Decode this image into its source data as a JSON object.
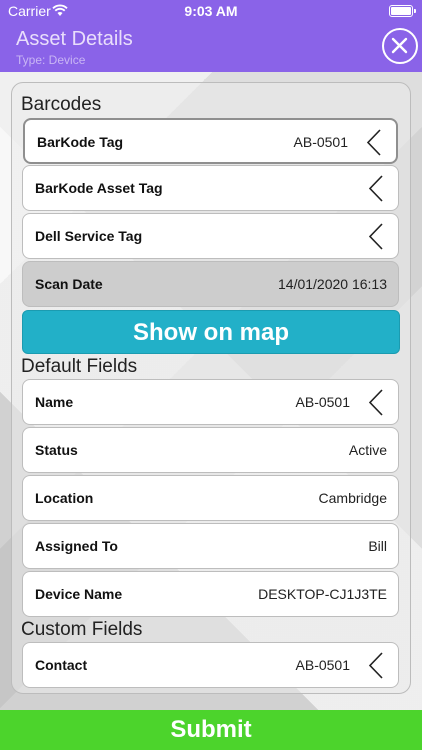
{
  "status_bar": {
    "carrier": "Carrier",
    "time": "9:03 AM"
  },
  "header": {
    "title": "Asset Details",
    "subtitle": "Type: Device",
    "close_icon": "close-icon"
  },
  "sections": {
    "barcodes": "Barcodes",
    "default_fields": "Default Fields",
    "custom_fields": "Custom Fields"
  },
  "barcodes": [
    {
      "label": "BarKode Tag",
      "value": "AB-0501",
      "chevron": true
    },
    {
      "label": "BarKode Asset Tag",
      "value": "",
      "chevron": true
    },
    {
      "label": "Dell Service Tag",
      "value": "",
      "chevron": true
    },
    {
      "label": "Scan Date",
      "value": "14/01/2020 16:13",
      "chevron": false
    }
  ],
  "map_button": "Show on map",
  "default_fields": [
    {
      "label": "Name",
      "value": "AB-0501",
      "chevron": true
    },
    {
      "label": "Status",
      "value": "Active",
      "chevron": false
    },
    {
      "label": "Location",
      "value": "Cambridge",
      "chevron": false
    },
    {
      "label": "Assigned To",
      "value": "Bill",
      "chevron": false
    },
    {
      "label": "Device Name",
      "value": "DESKTOP-CJ1J3TE",
      "chevron": false
    }
  ],
  "custom_fields": [
    {
      "label": "Contact",
      "value": "AB-0501",
      "chevron": true
    }
  ],
  "submit_button": "Submit",
  "colors": {
    "header": "#8a63e8",
    "map_button": "#22b0c8",
    "submit": "#4cd42c"
  }
}
